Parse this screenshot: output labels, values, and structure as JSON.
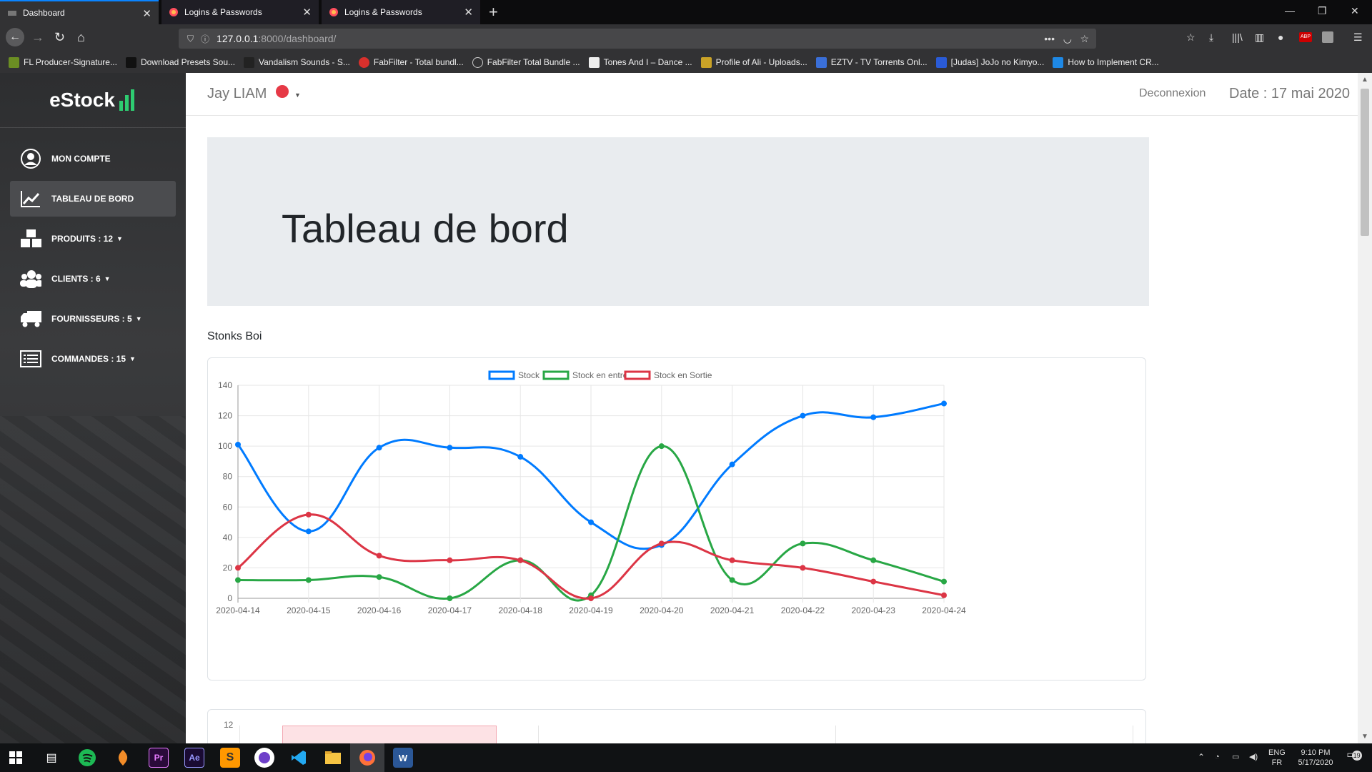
{
  "browser": {
    "tabs": [
      {
        "title": "Dashboard",
        "active": true
      },
      {
        "title": "Logins & Passwords",
        "active": false
      },
      {
        "title": "Logins & Passwords",
        "active": false
      }
    ],
    "url_host": "127.0.0.1",
    "url_path": ":8000/dashboard/",
    "bookmarks": [
      "FL Producer-Signature...",
      "Download Presets Sou...",
      "Vandalism Sounds - S...",
      "FabFilter - Total bundl...",
      "FabFilter Total Bundle ...",
      "Tones And I – Dance ...",
      "Profile of Ali - Uploads...",
      "EZTV - TV Torrents Onl...",
      "[Judas] JoJo no Kimyo...",
      "How to Implement CR..."
    ]
  },
  "sidebar": {
    "brand": "eStock",
    "items": [
      {
        "label": "MON COMPTE",
        "icon": "user-circle-icon",
        "dropdown": false
      },
      {
        "label": "TABLEAU DE BORD",
        "icon": "chart-line-icon",
        "dropdown": false,
        "active": true
      },
      {
        "label": "PRODUITS : 12",
        "icon": "boxes-icon",
        "dropdown": true
      },
      {
        "label": "CLIENTS : 6",
        "icon": "users-icon",
        "dropdown": true
      },
      {
        "label": "FOURNISSEURS : 5",
        "icon": "truck-icon",
        "dropdown": true
      },
      {
        "label": "COMMANDES : 15",
        "icon": "list-icon",
        "dropdown": true
      }
    ]
  },
  "header": {
    "user": "Jay LIAM",
    "logout": "Deconnexion",
    "date": "Date : 17 mai 2020"
  },
  "main": {
    "page_title": "Tableau de bord",
    "chart_section_title": "Stonks Boi",
    "second_chart_first_tick": "12"
  },
  "chart_data": {
    "type": "line",
    "categories": [
      "2020-04-14",
      "2020-04-15",
      "2020-04-16",
      "2020-04-17",
      "2020-04-18",
      "2020-04-19",
      "2020-04-20",
      "2020-04-21",
      "2020-04-22",
      "2020-04-23",
      "2020-04-24"
    ],
    "series": [
      {
        "name": "Stock",
        "color": "#007bff",
        "values": [
          101,
          44,
          99,
          99,
          93,
          50,
          35,
          88,
          120,
          119,
          128
        ]
      },
      {
        "name": "Stock en entré",
        "color": "#28a745",
        "values": [
          12,
          12,
          14,
          0,
          25,
          2,
          100,
          12,
          36,
          25,
          11
        ]
      },
      {
        "name": "Stock en Sortie",
        "color": "#dc3545",
        "values": [
          20,
          55,
          28,
          25,
          25,
          0,
          36,
          25,
          20,
          11,
          2
        ]
      }
    ],
    "ylim": [
      0,
      140
    ],
    "yticks": [
      0,
      20,
      40,
      60,
      80,
      100,
      120,
      140
    ],
    "legend": "top-center",
    "grid": true
  },
  "taskbar": {
    "lang_top": "ENG",
    "lang_bottom": "FR",
    "time": "9:10 PM",
    "date": "5/17/2020",
    "notifications": "19"
  }
}
